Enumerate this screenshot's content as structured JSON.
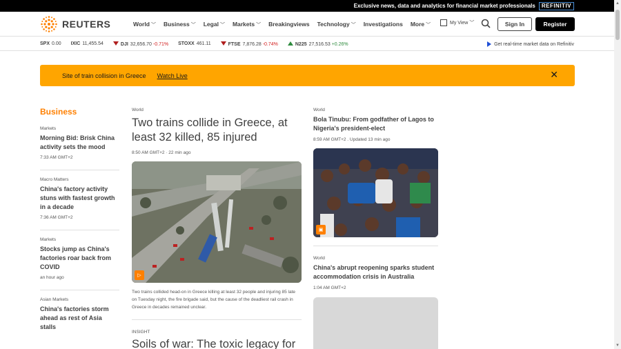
{
  "topbar": {
    "promo": "Exclusive news, data and analytics for financial market professionals",
    "brand": "REFINITIV"
  },
  "nav": {
    "logo": "REUTERS",
    "menu": [
      {
        "label": "World",
        "chevron": true
      },
      {
        "label": "Business",
        "chevron": true
      },
      {
        "label": "Legal",
        "chevron": true
      },
      {
        "label": "Markets",
        "chevron": true
      },
      {
        "label": "Breakingviews",
        "chevron": false
      },
      {
        "label": "Technology",
        "chevron": true
      },
      {
        "label": "Investigations",
        "chevron": false
      },
      {
        "label": "More",
        "chevron": true
      }
    ],
    "myview": "My View",
    "signin": "Sign In",
    "register": "Register"
  },
  "ticker": [
    {
      "name": "SPX",
      "value": "0.00",
      "change": "",
      "dir": "none"
    },
    {
      "name": "IXIC",
      "value": "11,455.54",
      "change": "",
      "dir": "none"
    },
    {
      "name": "DJI",
      "value": "32,656.70",
      "change": "-0.71%",
      "dir": "down"
    },
    {
      "name": "STOXX",
      "value": "461.11",
      "change": "",
      "dir": "none"
    },
    {
      "name": "FTSE",
      "value": "7,876.28",
      "change": "-0.74%",
      "dir": "down"
    },
    {
      "name": "N225",
      "value": "27,516.53",
      "change": "+0.26%",
      "dir": "up"
    }
  ],
  "realtime": "Get real-time market data on Refinitiv",
  "banner": {
    "text": "Site of train collision in Greece",
    "link": "Watch Live"
  },
  "business": {
    "heading": "Business",
    "items": [
      {
        "kicker": "Markets",
        "title": "Morning Bid: Brisk China activity sets the mood",
        "time": "7:33 AM GMT+2"
      },
      {
        "kicker": "Macro Matters",
        "title": "China's factory activity stuns with fastest growth in a decade",
        "time": "7:36 AM GMT+2"
      },
      {
        "kicker": "Markets",
        "title": "Stocks jump as China's factories roar back from COVID",
        "time": "an hour ago"
      },
      {
        "kicker": "Asian Markets",
        "title": "China's factories storm ahead as rest of Asia stalls",
        "time": ""
      }
    ]
  },
  "lead": {
    "kicker": "World",
    "title": "Two trains collide in Greece, at least 32 killed, 85 injured",
    "time": "8:50 AM GMT+2 · 22 min ago",
    "caption": "Two trains collided head-on in Greece killing at least 32 people and injuring 85 late on Tuesday night, the fire brigade said, but the cause of the deadliest rail crash in Greece in decades remained unclear.",
    "kicker2": "INSIGHT",
    "title2": "Soils of war: The toxic legacy for"
  },
  "right": {
    "items": [
      {
        "kicker": "World",
        "title": "Bola Tinubu: From godfather of Lagos to Nigeria's president-elect",
        "time": "8:59 AM GMT+2 . Updated 13 min ago"
      },
      {
        "kicker": "World",
        "title": "China's abrupt reopening sparks student accommodation crisis in Australia",
        "time": "1:04 AM GMT+2"
      }
    ]
  }
}
